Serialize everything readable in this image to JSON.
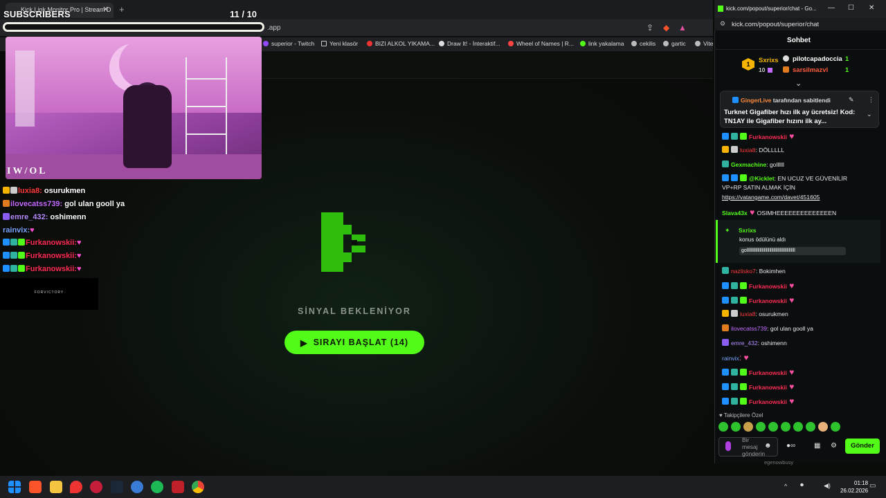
{
  "browser": {
    "tab_title": "Kick Link Monitor Pro | Stream D",
    "url_suffix": ".app",
    "bookmarks": [
      "superior - Twitch",
      "Yeni klasör",
      "BIZI ALKOL YIKAMA...",
      "Draw It! - İnteraktif...",
      "Wheel of Names | R...",
      "link yakalama",
      "cekilis",
      "gartic",
      "Vite"
    ]
  },
  "overlay": {
    "title": "SUBSCRIBERS",
    "count": "11  / 10",
    "cam_logo": "IW/OL",
    "sponsor": "FORVICTORY",
    "chat": [
      {
        "user": "luxia8:",
        "msg": " osurukmen",
        "color": "#ff3c3c"
      },
      {
        "user": "ilovecatss739:",
        "msg": " gol ulan gooll ya",
        "color": "#c36bff"
      },
      {
        "user": "emre_432:",
        "msg": " oshimenn",
        "color": "#b58cff"
      },
      {
        "user": "rainvix:",
        "msg": "",
        "color": "#7aa4ff"
      },
      {
        "user": "Furkanowskii:",
        "msg": "",
        "color": "#ff2d55"
      },
      {
        "user": "Furkanowskii:",
        "msg": "",
        "color": "#ff2d55"
      },
      {
        "user": "Furkanowskii:",
        "msg": "",
        "color": "#ff2d55"
      }
    ]
  },
  "app": {
    "status": "SİNYAL BEKLENİYOR",
    "start_label": "SIRAYI BAŞLAT (14)"
  },
  "kick": {
    "window_title": "kick.com/popout/superior/chat - Go...",
    "url": "kick.com/popout/superior/chat",
    "header": "Sohbet",
    "leaderboard": {
      "rank": "1",
      "leader": "Sxrixs",
      "leader_count": "10",
      "entries": [
        {
          "name": "pilotcapadoccia",
          "count": "1"
        },
        {
          "name": "sarsilmazvl",
          "count": "1"
        }
      ]
    },
    "pinned": {
      "by_user": "GingerLive",
      "by_text": " tarafından sabitlendi",
      "message": "Turknet Gigafiber hızı ilk ay ücretsiz! Kod: TN1AY ile Gigafiber hızını ilk ay..."
    },
    "messages_top": [
      {
        "user": "Furkanowskii",
        "msg": "",
        "color": "#ff2d55"
      },
      {
        "user": "luxia8",
        "msg": ": DÖLLLLL",
        "color": "#ff3c3c"
      },
      {
        "user": "Gexmachine",
        "msg": ": gollllll",
        "color": "#53fc18"
      },
      {
        "user": "@Kicklet",
        "msg": ": EN UCUZ VE GÜVENİLİR",
        "color": "#53fc18"
      }
    ],
    "kicklet_line2": "VP+RP SATIN ALMAK İÇİN",
    "kicklet_link": "https://vatangame.com/davet/451605",
    "slava": {
      "user": "Slava43x",
      "msg": "OSIMHEEEEEEEEEEEEEEN",
      "color": "#53fc18"
    },
    "reward": {
      "user": "Sxrixs",
      "text": "konus ödülünü aldı",
      "value": "golllllllllllllllllllllllllllllllllllllllllllll"
    },
    "messages_bottom": [
      {
        "user": "nazlisko7",
        "msg": ": Bokimhen",
        "color": "#ff3c3c"
      },
      {
        "user": "Furkanowskii",
        "msg": "",
        "color": "#ff2d55"
      },
      {
        "user": "Furkanowskii",
        "msg": "",
        "color": "#ff2d55"
      },
      {
        "user": "luxia8",
        "msg": ": osurukmen",
        "color": "#ff3c3c"
      },
      {
        "user": "ilovecatss739",
        "msg": ": gol ulan gooll ya",
        "color": "#c36bff"
      },
      {
        "user": "emre_432",
        "msg": ": oshimenn",
        "color": "#b58cff"
      },
      {
        "user": "rainvix",
        "msg": "",
        "color": "#7aa4ff"
      },
      {
        "user": "Furkanowskii",
        "msg": "",
        "color": "#ff2d55"
      },
      {
        "user": "Furkanowskii",
        "msg": "",
        "color": "#ff2d55"
      },
      {
        "user": "Furkanowskii",
        "msg": "",
        "color": "#ff2d55"
      }
    ],
    "follower_label": "Takipçilere Özel",
    "input_placeholder": "Bir mesaj gönderin",
    "send_label": "Gönder",
    "below_user": "egenowbusy",
    "below_link": "https://www.instagram.com/p/DVIpUcvjF8P/"
  },
  "taskbar": {
    "time": "01:18",
    "date": "26.02.2026"
  },
  "colors": {
    "kick_green": "#53fc18"
  }
}
